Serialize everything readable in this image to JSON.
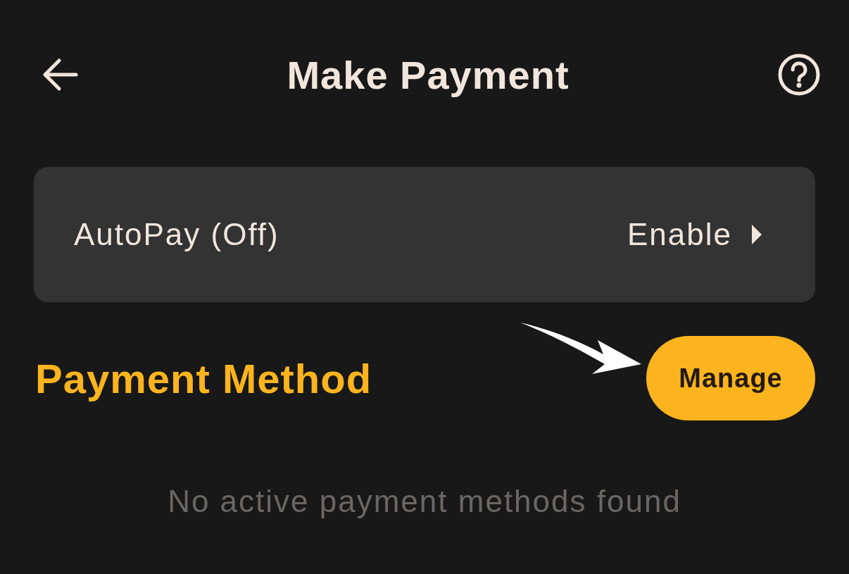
{
  "header": {
    "title": "Make Payment"
  },
  "autopay": {
    "label": "AutoPay (Off)",
    "action": "Enable"
  },
  "payment_method": {
    "heading": "Payment Method",
    "button": "Manage",
    "empty_message": "No active payment methods found"
  }
}
